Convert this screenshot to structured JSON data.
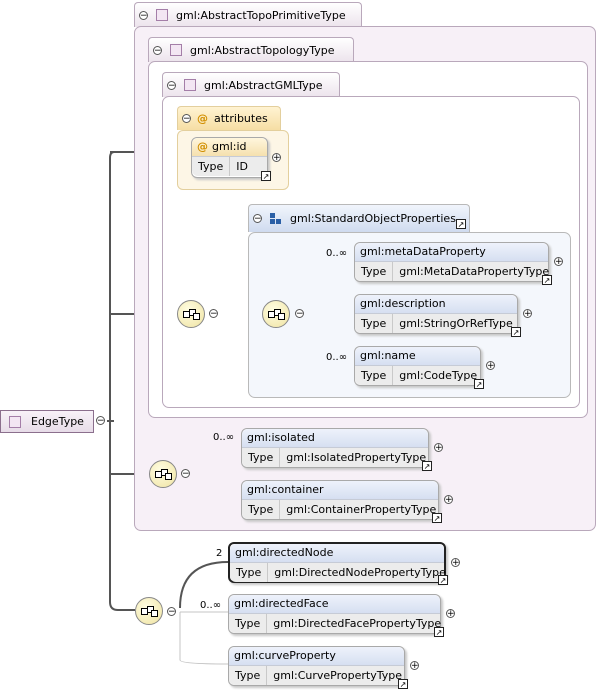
{
  "root": {
    "label": "EdgeType"
  },
  "types": {
    "topo_primitive": "gml:AbstractTopoPrimitiveType",
    "topology": "gml:AbstractTopologyType",
    "gml": "gml:AbstractGMLType"
  },
  "attributes": {
    "label": "attributes",
    "id": {
      "name": "gml:id",
      "type_key": "Type",
      "type": "ID"
    }
  },
  "group": {
    "label": "gml:StandardObjectProperties"
  },
  "elements": [
    {
      "name": "gml:metaDataProperty",
      "type_key": "Type",
      "type": "gml:MetaDataPropertyType",
      "card": "0..∞"
    },
    {
      "name": "gml:description",
      "type_key": "Type",
      "type": "gml:StringOrRefType",
      "card": ""
    },
    {
      "name": "gml:name",
      "type_key": "Type",
      "type": "gml:CodeType",
      "card": "0..∞"
    },
    {
      "name": "gml:isolated",
      "type_key": "Type",
      "type": "gml:IsolatedPropertyType",
      "card": "0..∞"
    },
    {
      "name": "gml:container",
      "type_key": "Type",
      "type": "gml:ContainerPropertyType",
      "card": ""
    },
    {
      "name": "gml:directedNode",
      "type_key": "Type",
      "type": "gml:DirectedNodePropertyType",
      "card": "2"
    },
    {
      "name": "gml:directedFace",
      "type_key": "Type",
      "type": "gml:DirectedFacePropertyType",
      "card": "0..∞"
    },
    {
      "name": "gml:curveProperty",
      "type_key": "Type",
      "type": "gml:CurvePropertyType",
      "card": ""
    }
  ],
  "symbols": {
    "minus": "−",
    "plus": "+",
    "at": "@",
    "nav": "↗"
  },
  "colors": {
    "type_fill": "#f7f0f7",
    "attr_fill": "#fdf6e6",
    "group_fill": "#f4f7fc",
    "line": "#555555"
  }
}
